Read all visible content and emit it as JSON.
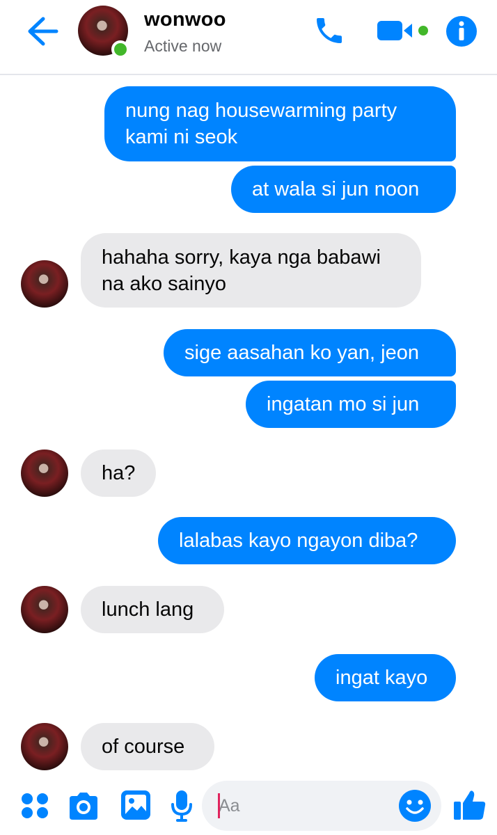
{
  "colors": {
    "accent": "#0084ff",
    "incoming_bubble": "#e9e9eb",
    "online": "#42b72a"
  },
  "header": {
    "contact_name": "wonwoo",
    "status": "Active now",
    "icons": [
      "back-arrow-icon",
      "phone-icon",
      "video-camera-icon",
      "info-icon"
    ]
  },
  "messages": [
    {
      "side": "out",
      "lines": [
        "nung nag housewarming party",
        "kami ni seok"
      ]
    },
    {
      "side": "out",
      "lines": [
        "at wala si jun noon"
      ]
    },
    {
      "side": "in",
      "lines": [
        "hahaha sorry, kaya nga babawi",
        "na ako sainyo"
      ]
    },
    {
      "side": "out",
      "lines": [
        "sige aasahan ko yan, jeon"
      ]
    },
    {
      "side": "out",
      "lines": [
        "ingatan mo si jun"
      ]
    },
    {
      "side": "in",
      "lines": [
        "ha?"
      ]
    },
    {
      "side": "out",
      "lines": [
        "lalabas kayo ngayon diba?"
      ]
    },
    {
      "side": "in",
      "lines": [
        "lunch lang"
      ]
    },
    {
      "side": "out",
      "lines": [
        "ingat kayo"
      ]
    },
    {
      "side": "in",
      "lines": [
        "of course"
      ]
    }
  ],
  "composer": {
    "placeholder": "Aa",
    "icons": [
      "apps-grid-icon",
      "camera-icon",
      "image-icon",
      "microphone-icon",
      "emoji-icon",
      "thumbs-up-icon"
    ]
  }
}
